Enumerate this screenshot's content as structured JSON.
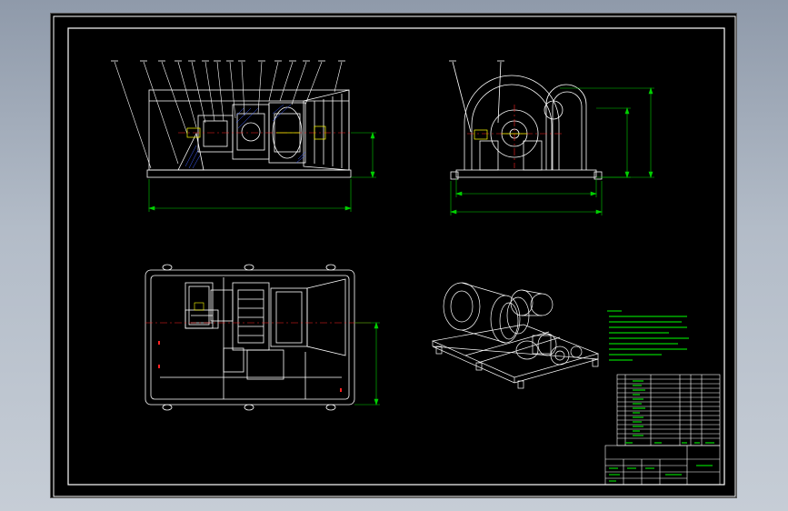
{
  "drawing": {
    "background": "#000000",
    "line_color": "#ffffff",
    "dim_color": "#00d000",
    "center_color": "#ff2020",
    "accent_color": "#ffff00",
    "hatch_color": "#4060ff",
    "note_lines": 9,
    "bom_rows": 14
  },
  "dimensions": {
    "front_overall": "",
    "front_height": "",
    "side_base": "",
    "side_overall": "",
    "side_height": "",
    "side_total_height": "",
    "plan_depth": ""
  },
  "title_block": {
    "label": ""
  }
}
